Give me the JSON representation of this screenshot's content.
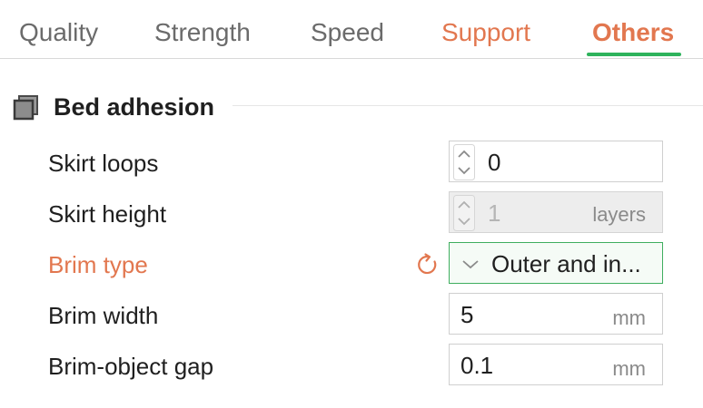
{
  "tabs": [
    {
      "label": "Quality"
    },
    {
      "label": "Strength"
    },
    {
      "label": "Speed"
    },
    {
      "label": "Support"
    },
    {
      "label": "Others"
    }
  ],
  "active_tab": "Others",
  "colors": {
    "accent_modified": "#e2774f",
    "accent_active_underline": "#2eb35c",
    "focus_border": "#3fae5f"
  },
  "section": {
    "title": "Bed adhesion",
    "icon": "section-cube-icon"
  },
  "settings": [
    {
      "label": "Skirt loops",
      "value": "0",
      "unit": ""
    },
    {
      "label": "Skirt height",
      "value": "1",
      "unit": "layers"
    },
    {
      "label": "Brim type",
      "value": "Outer and in...",
      "unit": ""
    },
    {
      "label": "Brim width",
      "value": "5",
      "unit": "mm"
    },
    {
      "label": "Brim-object gap",
      "value": "0.1",
      "unit": "mm"
    }
  ]
}
